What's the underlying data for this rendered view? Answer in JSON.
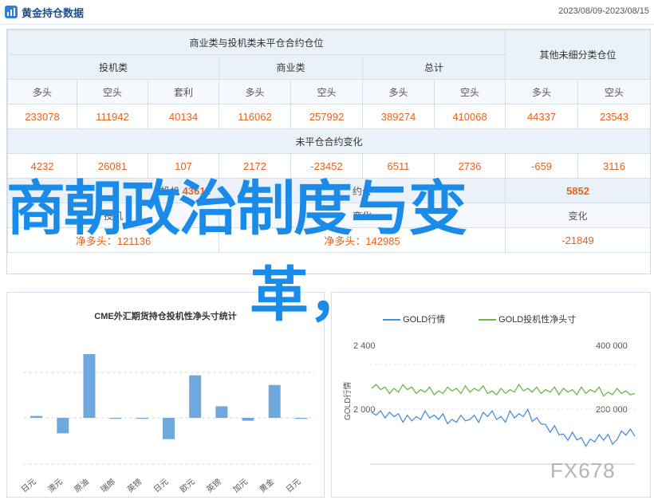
{
  "header": {
    "title": "黄金持仓数据",
    "date_range": "2023/08/09-2023/08/15",
    "logo_icon": "chart-logo-icon"
  },
  "table": {
    "top_header": "商业类与投机类未平仓合约仓位",
    "other_header": "其他未细分类仓位",
    "groups": [
      "投机类",
      "商业类",
      "总计"
    ],
    "cols": [
      "多头",
      "空头",
      "套利",
      "多头",
      "空头",
      "多头",
      "空头",
      "多头",
      "空头"
    ],
    "values": [
      "233078",
      "111942",
      "40134",
      "116062",
      "257992",
      "389274",
      "410068",
      "44337",
      "23543"
    ],
    "change_header": "未平仓合约变化",
    "changes": [
      "4232",
      "26081",
      "107",
      "2172",
      "-23452",
      "6511",
      "2736",
      "-659",
      "3116"
    ],
    "overlay_row1": [
      "",
      "",
      "",
      "",
      "",
      "",
      "",
      "",
      "5852"
    ],
    "overlay_row1_left": "43611",
    "net_row_labels": [
      "净多头：121136",
      "净多头：142985",
      "-21849"
    ],
    "frag_a": "投机",
    "frag_b": "约仓",
    "frag_c": "变化"
  },
  "watermark": {
    "line1": "商朝政治制度与变",
    "line2": "革，"
  },
  "left_chart_title": "CME外汇期货持仓投机性净头寸统计",
  "right_chart": {
    "legend1": "GOLD行情",
    "legend2": "GOLD投机性净头寸",
    "y_left_ticks": [
      "2 400",
      "2 000"
    ],
    "y_right_ticks": [
      "400 000",
      "200 000"
    ],
    "y_left_label": "GOLD行情",
    "colors": {
      "price": "#4a90d9",
      "net": "#6ab84a"
    }
  },
  "chart_data": {
    "type": "bar",
    "title": "CME外汇期货持仓投机性净头寸统计",
    "categories": [
      "日元",
      "澳元",
      "原油",
      "瑞郎",
      "英镑",
      "日元",
      "欧元",
      "英镑",
      "加元",
      "黄金",
      "日元"
    ],
    "values": [
      1,
      -8,
      33,
      -0.5,
      -0.5,
      -11,
      22,
      6,
      -1.5,
      17,
      -0.5
    ],
    "ylim": [
      -30,
      40
    ]
  },
  "watermark_logo": "FX678"
}
